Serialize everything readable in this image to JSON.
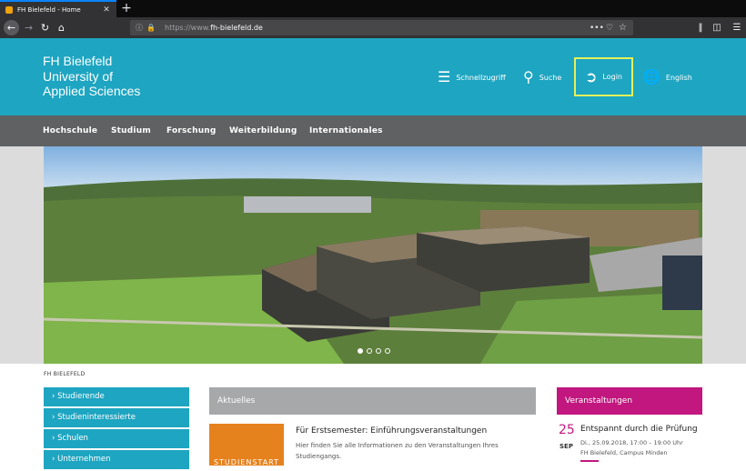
{
  "browser": {
    "tab_title": "FH Bielefeld - Home",
    "tab_close": "✕",
    "new_tab": "+",
    "url_scheme": "https://www.",
    "url_host": "fh-bielefeld.de",
    "url_more": "•••",
    "icons": [
      "back-icon",
      "forward-icon",
      "reload-icon",
      "home-icon",
      "info-icon",
      "lock-icon",
      "pocket-icon",
      "star-icon",
      "library-icon",
      "sidebar-icon",
      "hamburger-menu-icon"
    ]
  },
  "header": {
    "logo_line1": "FH Bielefeld",
    "logo_line2": "University of",
    "logo_line3": "Applied Sciences",
    "quick_access": "Schnellzugriff",
    "search": "Suche",
    "login": "Login",
    "language": "English"
  },
  "nav": {
    "items": [
      "Hochschule",
      "Studium",
      "Forschung",
      "Weiterbildung",
      "Internationales"
    ]
  },
  "hero": {
    "slide_count": 4,
    "active_slide": 1
  },
  "breadcrumb": "FH BIELEFELD",
  "sidebar": {
    "items": [
      "Studierende",
      "Studieninteressierte",
      "Schulen",
      "Unternehmen"
    ]
  },
  "news": {
    "heading": "Aktuelles",
    "image_text": "STUDIENSTART",
    "item_title": "Für Erstsemester: Einführungsveranstaltungen",
    "item_desc": "Hier finden Sie alle Informationen zu den Veranstaltungen Ihres Studiengangs."
  },
  "events": {
    "heading": "Veranstaltungen",
    "day": "25",
    "month": "SEP",
    "title": "Entspannt durch die Prüfung",
    "time": "Di., 25.09.2018, 17:00 – 19:00 Uhr",
    "location": "FH Bielefeld, Campus Minden"
  },
  "colors": {
    "brand_teal": "#1ea5c1",
    "nav_gray": "#5f6163",
    "events_magenta": "#c1177f",
    "news_orange": "#e6821e",
    "login_highlight": "#e6f15a"
  }
}
